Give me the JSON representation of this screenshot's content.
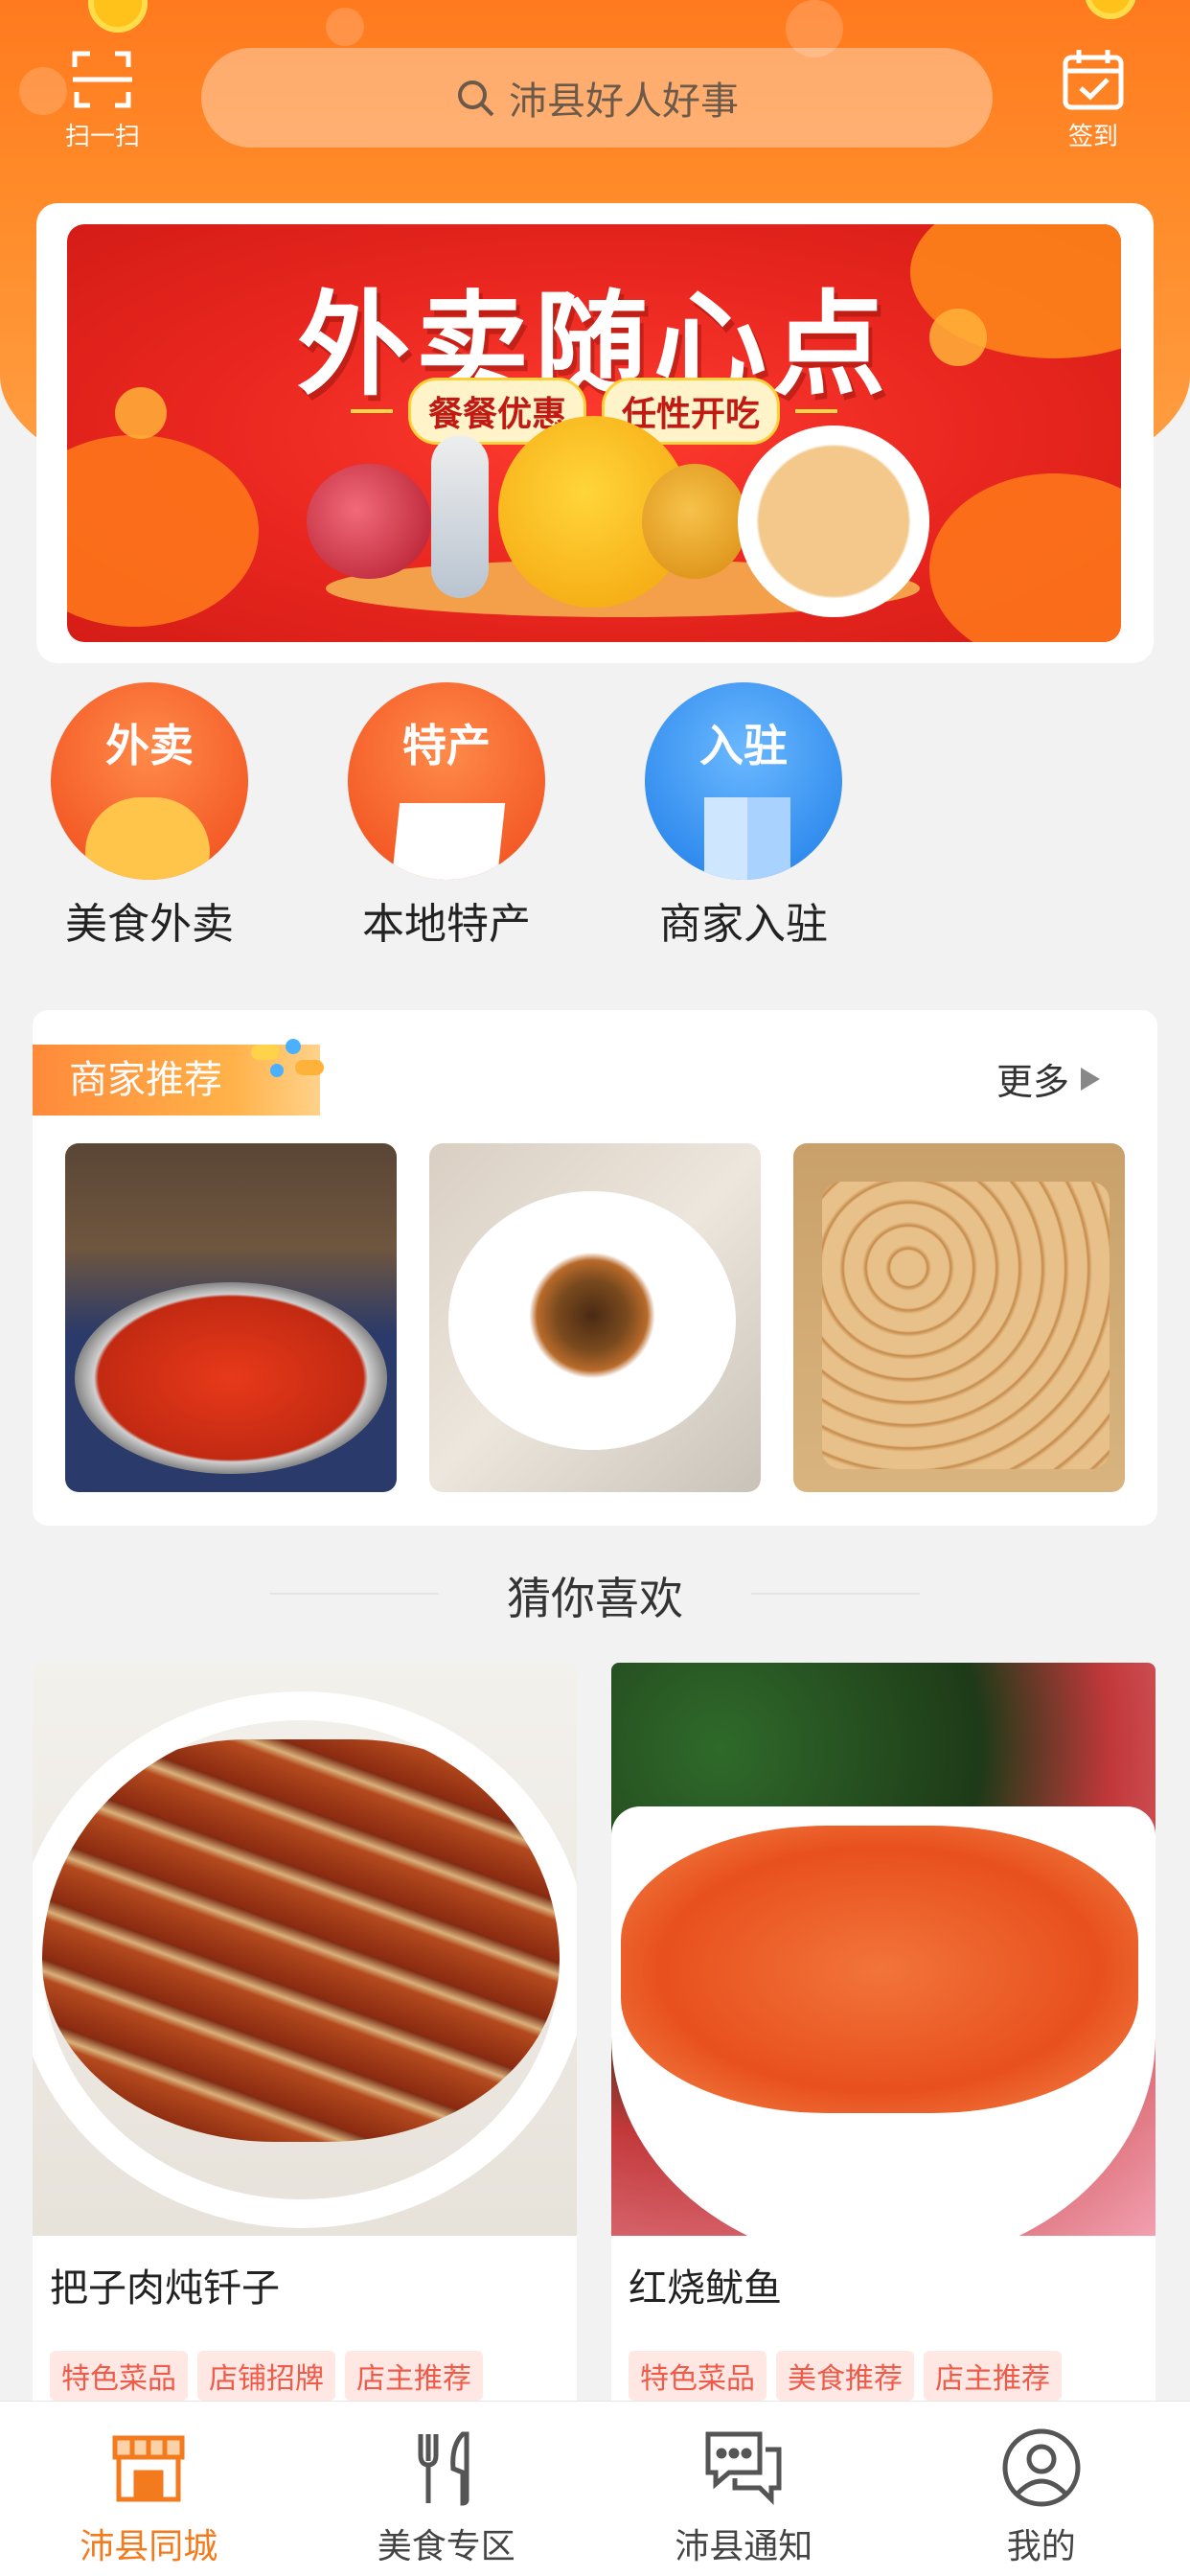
{
  "header": {
    "scan_label": "扫一扫",
    "signin_label": "签到",
    "search_placeholder": "沛县好人好事"
  },
  "banner": {
    "title": "外卖随心点",
    "tag1": "餐餐优惠",
    "tag2": "任性开吃"
  },
  "categories": [
    {
      "badge": "外卖",
      "label": "美食外卖",
      "icon": "roast-chicken-icon"
    },
    {
      "badge": "特产",
      "label": "本地特产",
      "icon": "takeout-box-icon"
    },
    {
      "badge": "入驻",
      "label": "商家入驻",
      "icon": "building-icon"
    }
  ],
  "merchant": {
    "title": "商家推荐",
    "more_label": "更多",
    "photos": [
      "crayfish-dish",
      "braised-sea-cucumber",
      "tofu-skin-rolls"
    ]
  },
  "guess": {
    "title": "猜你喜欢",
    "items": [
      {
        "name": "把子肉炖钎子",
        "tags": [
          "特色菜品",
          "店铺招牌",
          "店主推荐"
        ]
      },
      {
        "name": "红烧鱿鱼",
        "tags": [
          "特色菜品",
          "美食推荐",
          "店主推荐"
        ]
      }
    ]
  },
  "tabbar": {
    "tabs": [
      {
        "label": "沛县同城",
        "icon": "storefront-icon",
        "active": true
      },
      {
        "label": "美食专区",
        "icon": "fork-knife-icon",
        "active": false
      },
      {
        "label": "沛县通知",
        "icon": "chat-bubbles-icon",
        "active": false
      },
      {
        "label": "我的",
        "icon": "user-profile-icon",
        "active": false
      }
    ]
  },
  "colors": {
    "accent": "#f47a1e",
    "header": "#ff8c2a",
    "banner_red": "#e8261f",
    "tag_text": "#f05a48"
  }
}
